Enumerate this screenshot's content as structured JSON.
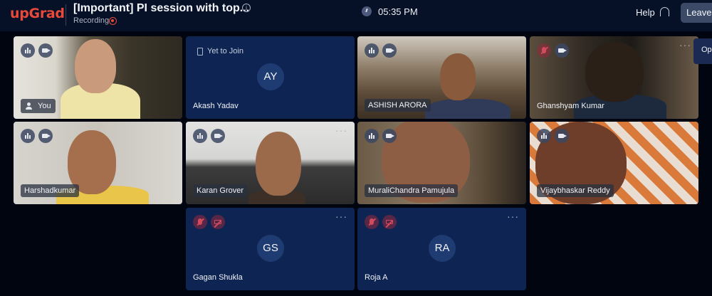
{
  "header": {
    "logo": "upGrad",
    "title": "[Important] PI session with top...",
    "recording_label": "Recording",
    "time": "05:35 PM",
    "help_label": "Help",
    "leave_label": "Leave",
    "options_label": "Op",
    "icons": {
      "info": "info-icon",
      "recording": "recording-dot-icon",
      "clock": "clock-icon",
      "headset": "headset-icon"
    },
    "colors": {
      "brand": "#e8493a",
      "header_bg": "#061026",
      "tile_bg": "#0e2553"
    }
  },
  "participants": [
    {
      "name": "You",
      "video": true,
      "self": true
    },
    {
      "name": "Akash Yadav",
      "initials": "AY",
      "status": "Yet to Join",
      "video": false
    },
    {
      "name": "ASHISH ARORA",
      "video": true
    },
    {
      "name": "Ghanshyam Kumar",
      "video": true,
      "mic_muted": true
    },
    {
      "name": "Harshadkumar",
      "video": true
    },
    {
      "name": "Karan Grover",
      "video": true
    },
    {
      "name": "MuraliChandra Pamujula",
      "video": true
    },
    {
      "name": "Vijaybhaskar Reddy",
      "video": true
    },
    {
      "name": "Gagan Shukla",
      "initials": "GS",
      "video": false,
      "mic_muted": true,
      "cam_off": true
    },
    {
      "name": "Roja A",
      "initials": "RA",
      "video": false,
      "mic_muted": true,
      "cam_off": true
    }
  ],
  "more_label": "···"
}
